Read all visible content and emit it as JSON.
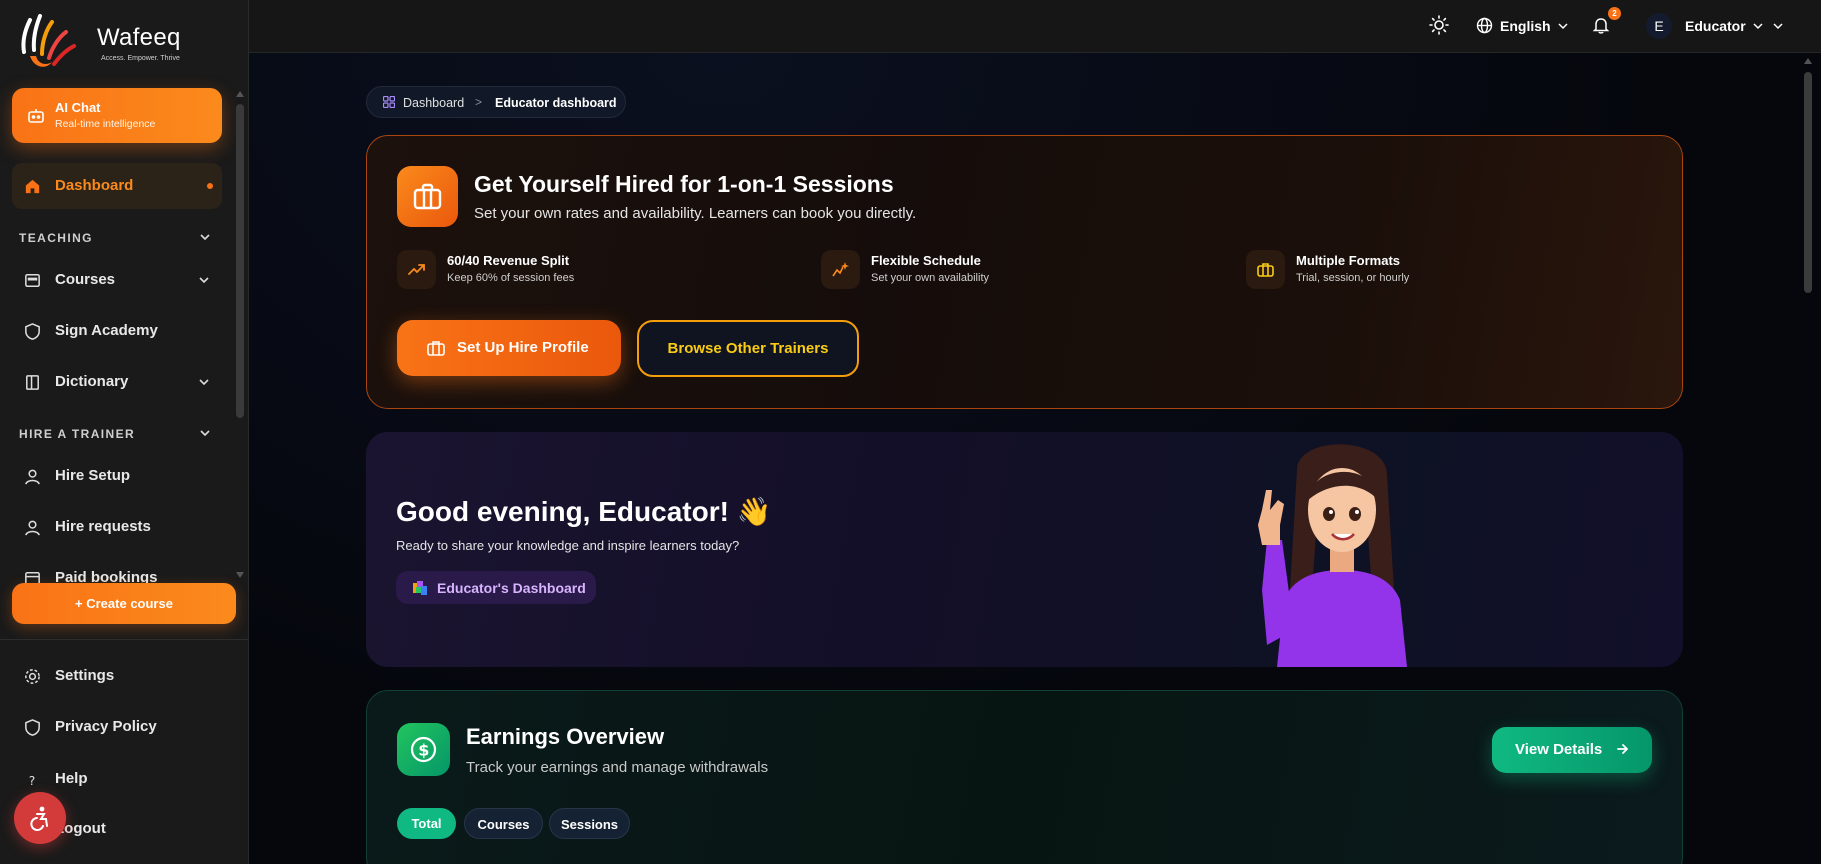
{
  "brand": {
    "name": "Wafeeq",
    "tagline": "Access. Empower. Thrive"
  },
  "sidebar": {
    "ai_chat": {
      "title": "AI Chat",
      "subtitle": "Real-time intelligence"
    },
    "dashboard": "Dashboard",
    "sections": {
      "teaching": "TEACHING",
      "hire": "HIRE A TRAINER"
    },
    "items": {
      "courses": "Courses",
      "sign_academy": "Sign Academy",
      "dictionary": "Dictionary",
      "hire_setup": "Hire Setup",
      "hire_requests": "Hire requests",
      "paid_bookings": "Paid bookings"
    },
    "create_course": "+ Create course",
    "bottom": {
      "settings": "Settings",
      "privacy": "Privacy Policy",
      "help": "Help",
      "logout": "Logout"
    }
  },
  "topbar": {
    "language": "English",
    "notifications_count": "2",
    "user_initial": "E",
    "user_name": "Educator"
  },
  "breadcrumb": {
    "root": "Dashboard",
    "separator": ">",
    "current": "Educator dashboard"
  },
  "hire_card": {
    "title": "Get Yourself Hired for 1-on-1 Sessions",
    "subtitle": "Set your own rates and availability. Learners can book you directly.",
    "features": [
      {
        "title": "60/40 Revenue Split",
        "subtitle": "Keep 60% of session fees",
        "icon": "trending-up-icon"
      },
      {
        "title": "Flexible Schedule",
        "subtitle": "Set your own availability",
        "icon": "sparkle-chart-icon"
      },
      {
        "title": "Multiple Formats",
        "subtitle": "Trial, session, or hourly",
        "icon": "briefcase-icon"
      }
    ],
    "primary_button": "Set Up Hire Profile",
    "secondary_button": "Browse Other Trainers"
  },
  "greeting": {
    "title": "Good evening, Educator! 👋",
    "subtitle": "Ready to share your knowledge and inspire learners today?",
    "pill": "Educator's Dashboard"
  },
  "earnings": {
    "title": "Earnings Overview",
    "subtitle": "Track your earnings and manage withdrawals",
    "view_button": "View Details",
    "tabs": [
      "Total",
      "Courses",
      "Sessions"
    ],
    "active_tab": "Total"
  },
  "colors": {
    "accent": "#f97316",
    "success": "#10b981",
    "purple": "#a855f7"
  }
}
